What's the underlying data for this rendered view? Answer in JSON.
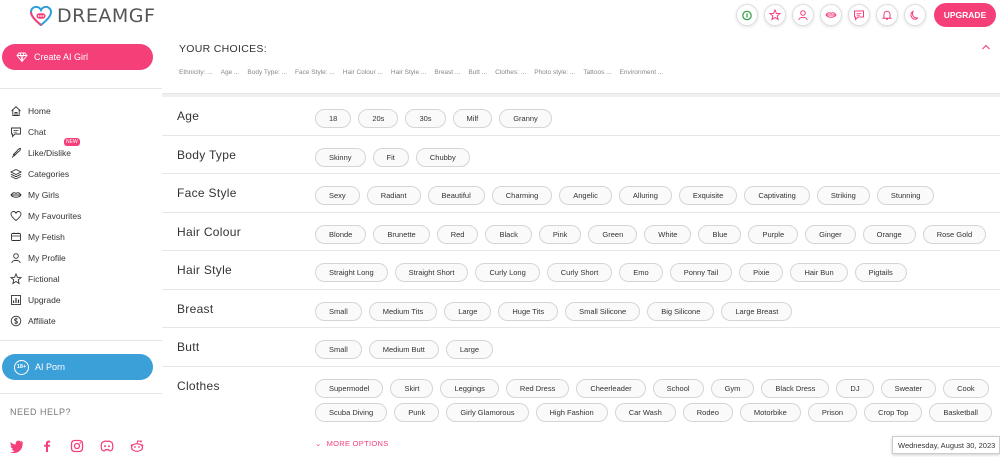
{
  "app": {
    "logo_text": "DREAMGF",
    "upgrade_label": "UPGRADE"
  },
  "top_icons": [
    "coin-icon",
    "star-icon",
    "user-icon",
    "lips-icon",
    "chat-icon",
    "bell-icon",
    "moon-icon"
  ],
  "sidebar": {
    "create_label": "Create AI Girl",
    "items": [
      {
        "label": "Home",
        "icon": "home-icon"
      },
      {
        "label": "Chat",
        "icon": "chat-icon"
      },
      {
        "label": "Like/Dislike",
        "icon": "flame-icon",
        "badge": "NEW"
      },
      {
        "label": "Categories",
        "icon": "layers-icon"
      },
      {
        "label": "My Girls",
        "icon": "lips-icon"
      },
      {
        "label": "My Favourites",
        "icon": "heart-icon"
      },
      {
        "label": "My Fetish",
        "icon": "fetish-icon"
      },
      {
        "label": "My Profile",
        "icon": "user-icon"
      },
      {
        "label": "Fictional",
        "icon": "star-icon"
      },
      {
        "label": "Upgrade",
        "icon": "chart-icon"
      },
      {
        "label": "Affiliate",
        "icon": "dollar-icon"
      }
    ],
    "ai_porn_label": "AI Porn",
    "ai_porn_badge": "18+",
    "need_help": "NEED HELP?",
    "socials": [
      "twitter-icon",
      "facebook-icon",
      "instagram-icon",
      "discord-icon",
      "reddit-icon"
    ]
  },
  "choices": {
    "title": "YOUR CHOICES:",
    "tags": [
      "Ethnicity: ...",
      "Age ...",
      "Body Type: ...",
      "Face Style: ...",
      "Hair Colour ...",
      "Hair Style ...",
      "Breast ...",
      "Butt ...",
      "Clothes: ...",
      "Photo style: ...",
      "Tattoos ...",
      "Environment ..."
    ]
  },
  "rows": [
    {
      "label": "Age",
      "options": [
        "18",
        "20s",
        "30s",
        "Milf",
        "Granny"
      ]
    },
    {
      "label": "Body Type",
      "options": [
        "Skinny",
        "Fit",
        "Chubby"
      ]
    },
    {
      "label": "Face Style",
      "options": [
        "Sexy",
        "Radiant",
        "Beautiful",
        "Charming",
        "Angelic",
        "Alluring",
        "Exquisite",
        "Captivating",
        "Striking",
        "Stunning"
      ]
    },
    {
      "label": "Hair Colour",
      "options": [
        "Blonde",
        "Brunette",
        "Red",
        "Black",
        "Pink",
        "Green",
        "White",
        "Blue",
        "Purple",
        "Ginger",
        "Orange",
        "Rose Gold"
      ]
    },
    {
      "label": "Hair Style",
      "options": [
        "Straight Long",
        "Straight Short",
        "Curly Long",
        "Curly Short",
        "Emo",
        "Ponny Tail",
        "Pixie",
        "Hair Bun",
        "Pigtails"
      ]
    },
    {
      "label": "Breast",
      "options": [
        "Small",
        "Medium Tits",
        "Large",
        "Huge Tits",
        "Small Silicone",
        "Big Silicone",
        "Large Breast"
      ]
    },
    {
      "label": "Butt",
      "options": [
        "Small",
        "Medium Butt",
        "Large"
      ]
    },
    {
      "label": "Clothes",
      "options": [
        "Supermodel",
        "Skirt",
        "Leggings",
        "Red Dress",
        "Cheerleader",
        "School",
        "Gym",
        "Black Dress",
        "DJ",
        "Sweater",
        "Cook",
        "Scuba Diving",
        "Punk",
        "Girly Glamorous",
        "High Fashion",
        "Car Wash",
        "Rodeo",
        "Motorbike",
        "Prison",
        "Crop Top",
        "Basketball"
      ]
    }
  ],
  "more_options": "MORE OPTIONS",
  "date_tooltip": "Wednesday, August 30, 2023",
  "colors": {
    "accent": "#f43f79",
    "blue": "#3b9fd8"
  }
}
